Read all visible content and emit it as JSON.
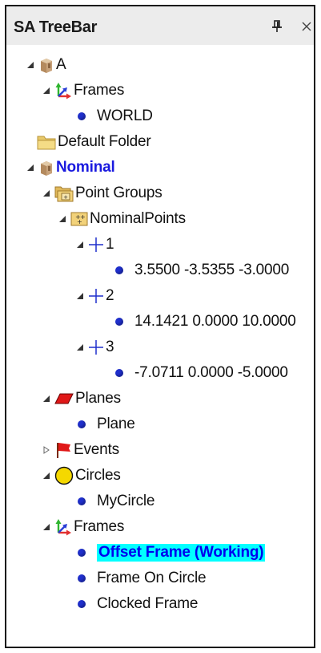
{
  "panel": {
    "title": "SA TreeBar",
    "pin_glyph": "🖈",
    "close_glyph": "×"
  },
  "tree": {
    "a": "A",
    "frames_1": "Frames",
    "world": "WORLD",
    "default_folder": "Default Folder",
    "nominal": "Nominal",
    "point_groups": "Point Groups",
    "nominal_points": "NominalPoints",
    "pt1": "1",
    "pt1_coords": "3.5500 -3.5355 -3.0000",
    "pt2": "2",
    "pt2_coords": "14.1421 0.0000 10.0000",
    "pt3": "3",
    "pt3_coords": "-7.0711 0.0000 -5.0000",
    "planes": "Planes",
    "plane": "Plane",
    "events": "Events",
    "circles": "Circles",
    "mycircle": "MyCircle",
    "frames_2": "Frames",
    "offset_frame": "Offset Frame (Working)",
    "frame_on_circle": "Frame On Circle",
    "clocked_frame": "Clocked Frame"
  },
  "colors": {
    "selection_bg": "#00ffff",
    "bold_item": "#1a1adf",
    "bullet": "#1f2fcc"
  }
}
